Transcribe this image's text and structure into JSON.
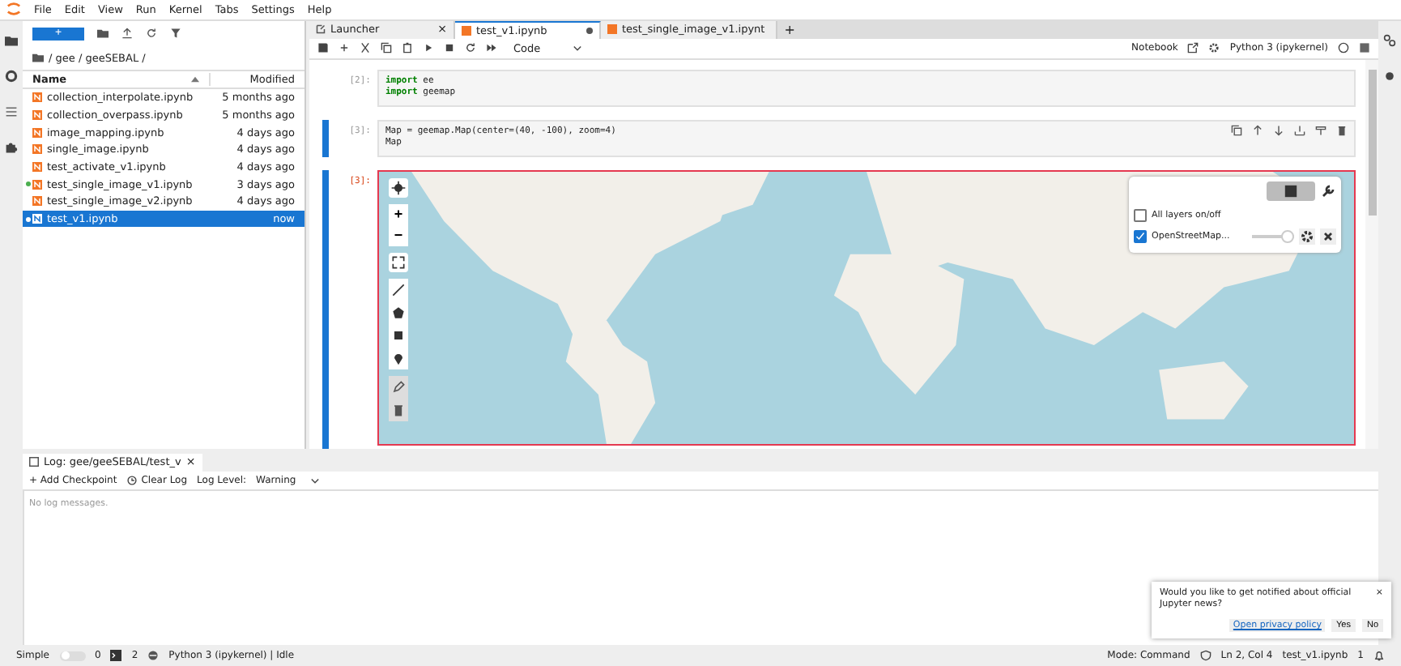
{
  "menu": [
    "File",
    "Edit",
    "View",
    "Run",
    "Kernel",
    "Tabs",
    "Settings",
    "Help"
  ],
  "file_browser": {
    "new_button": "+",
    "breadcrumb": "/ gee / geeSEBAL /",
    "columns": [
      "Name",
      "Modified"
    ],
    "files": [
      {
        "name": "collection_interpolate.ipynb",
        "modified": "5 months ago",
        "selected": false,
        "running": false
      },
      {
        "name": "collection_overpass.ipynb",
        "modified": "5 months ago",
        "selected": false,
        "running": false
      },
      {
        "name": "image_mapping.ipynb",
        "modified": "4 days ago",
        "selected": false,
        "running": false
      },
      {
        "name": "single_image.ipynb",
        "modified": "4 days ago",
        "selected": false,
        "running": false
      },
      {
        "name": "test_activate_v1.ipynb",
        "modified": "4 days ago",
        "selected": false,
        "running": false
      },
      {
        "name": "test_single_image_v1.ipynb",
        "modified": "3 days ago",
        "selected": false,
        "running": true
      },
      {
        "name": "test_single_image_v2.ipynb",
        "modified": "4 days ago",
        "selected": false,
        "running": false
      },
      {
        "name": "test_v1.ipynb",
        "modified": "now",
        "selected": true,
        "running": true
      }
    ]
  },
  "tabs": [
    {
      "label": "Launcher",
      "kind": "launcher",
      "selected": false,
      "dirty": false,
      "close": "×"
    },
    {
      "label": "test_v1.ipynb",
      "kind": "notebook",
      "selected": true,
      "dirty": true
    },
    {
      "label": "test_single_image_v1.ipynt",
      "kind": "notebook",
      "selected": false,
      "dirty": false
    }
  ],
  "add_tab": "+",
  "toolbar": {
    "cell_type": "Code",
    "notebook_link": "Notebook",
    "kernel": "Python 3 (ipykernel)"
  },
  "cells": [
    {
      "prompt": "[2]:",
      "active": false,
      "lines": [
        [
          {
            "text": "import",
            "kind": "keyword"
          },
          {
            "text": " ee",
            "kind": "plain"
          }
        ],
        [
          {
            "text": "import",
            "kind": "keyword"
          },
          {
            "text": " geemap",
            "kind": "plain"
          }
        ]
      ]
    },
    {
      "prompt": "[3]:",
      "active": true,
      "lines": [
        [
          {
            "text": "Map = geemap.Map(center=(40, -100), zoom=4)",
            "kind": "plain"
          }
        ],
        [
          {
            "text": "Map",
            "kind": "plain"
          }
        ]
      ]
    }
  ],
  "output": {
    "prompt": "[3]:",
    "zoom_in": "+",
    "zoom_out": "−",
    "layers": [
      {
        "label": "All layers on/off",
        "checked": false
      },
      {
        "label": "OpenStreetMap...",
        "checked": true,
        "level": 0.85
      }
    ]
  },
  "log": {
    "tab": "Log: gee/geeSEBAL/test_v",
    "close": "×",
    "add_checkpoint": "+ Add Checkpoint",
    "clear": "Clear Log",
    "level_label": "Log Level:",
    "level_value": "Warning",
    "empty": "No log messages."
  },
  "notification": {
    "text": "Would you like to get notified about official Jupyter news?",
    "close": "×",
    "link": "Open privacy policy",
    "buttons": [
      "Yes",
      "No"
    ]
  },
  "status": {
    "simple": "Simple",
    "simple_on": false,
    "terminals": "0",
    "kernels": "2",
    "kernel": "Python 3 (ipykernel) | Idle",
    "mode": "Mode: Command",
    "position": "Ln 2, Col 4",
    "file": "test_v1.ipynb",
    "count": "1"
  }
}
